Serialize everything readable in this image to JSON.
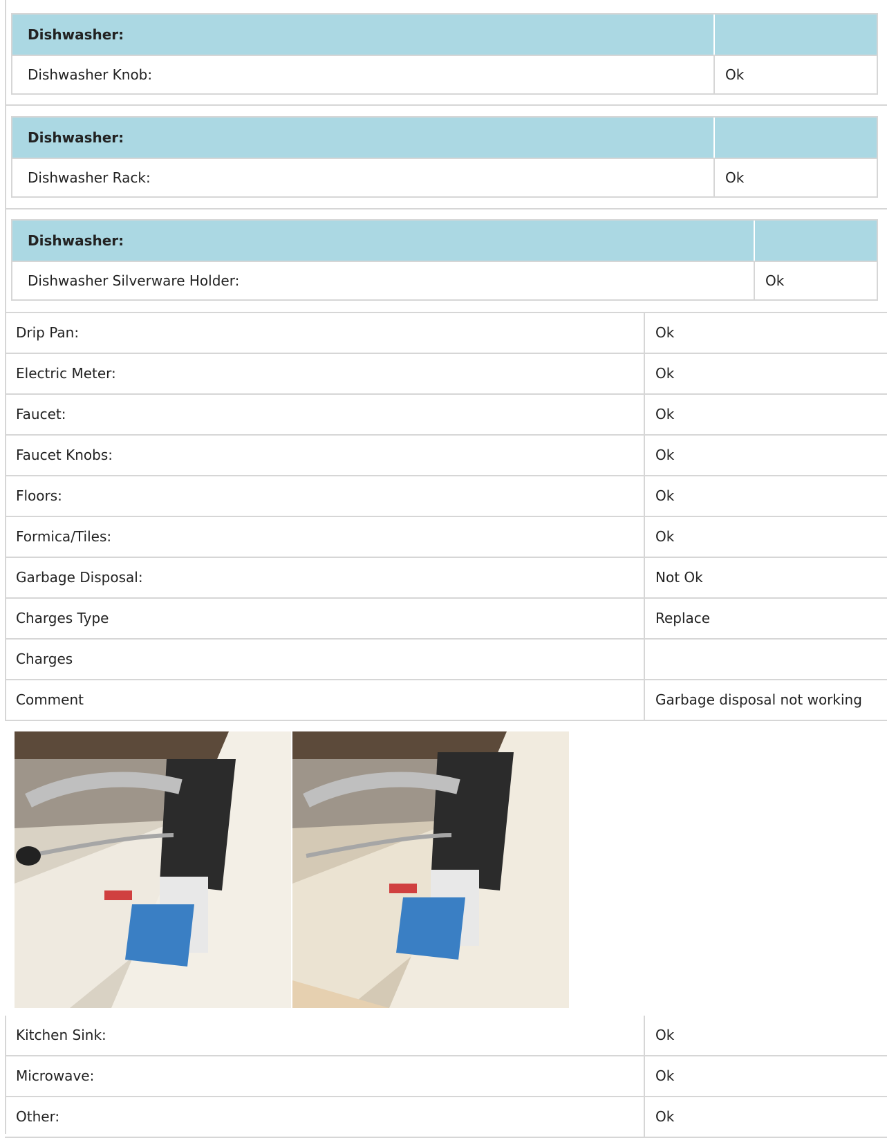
{
  "dishwasher_sections": [
    {
      "header": "Dishwasher:",
      "item": "Dishwasher Knob:",
      "value": "Ok"
    },
    {
      "header": "Dishwasher:",
      "item": "Dishwasher Rack:",
      "value": "Ok"
    },
    {
      "header": "Dishwasher:",
      "item": "Dishwasher Silverware Holder:",
      "value": "Ok"
    }
  ],
  "rows": [
    {
      "label": "Drip Pan:",
      "value": "Ok"
    },
    {
      "label": "Electric Meter:",
      "value": "Ok"
    },
    {
      "label": "Faucet:",
      "value": "Ok"
    },
    {
      "label": "Faucet Knobs:",
      "value": "Ok"
    },
    {
      "label": "Floors:",
      "value": "Ok"
    },
    {
      "label": "Formica/Tiles:",
      "value": "Ok"
    },
    {
      "label": "Garbage Disposal:",
      "value": "Not Ok"
    },
    {
      "label": "Charges Type",
      "value": "Replace"
    },
    {
      "label": "Charges",
      "value": ""
    },
    {
      "label": "Comment",
      "value": "Garbage disposal not working"
    }
  ],
  "photos": [
    {
      "subject": "garbage-disposal-photo"
    },
    {
      "subject": "garbage-disposal-photo"
    }
  ],
  "rows2": [
    {
      "label": "Kitchen Sink:",
      "value": "Ok"
    },
    {
      "label": "Microwave:",
      "value": "Ok"
    },
    {
      "label": "Other:",
      "value": "Ok"
    }
  ],
  "colors": {
    "header_bg": "#abd8e3",
    "border": "#d6d6d6"
  }
}
